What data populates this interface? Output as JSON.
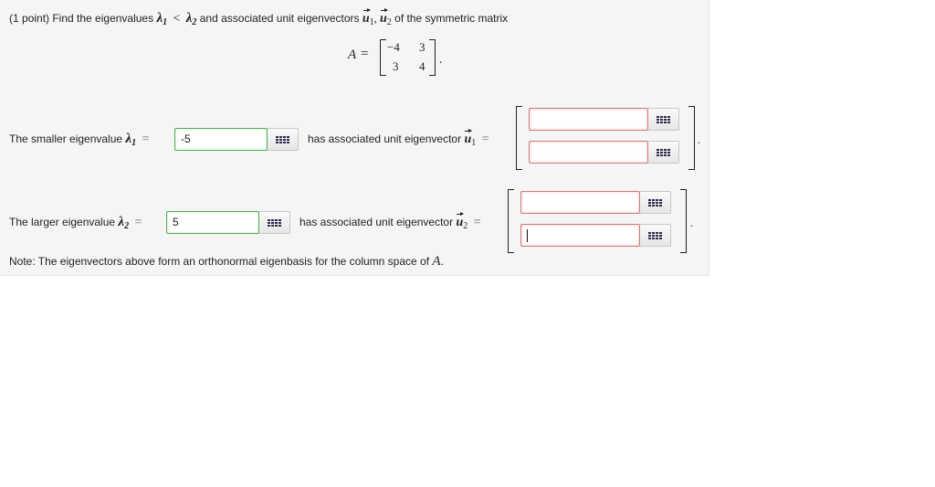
{
  "problem": {
    "prefix": "(1 point) Find the eigenvalues",
    "lambda": "λ",
    "one": "1",
    "two": "2",
    "lt": "<",
    "mid": "and associated unit eigenvectors",
    "u": "u",
    "comma": ",",
    "suffix": "of the symmetric matrix"
  },
  "matrix": {
    "name": "A",
    "eq": "=",
    "rows": [
      [
        "−4",
        "3"
      ],
      [
        "3",
        "4"
      ]
    ],
    "dot": "."
  },
  "row1": {
    "label": "The smaller eigenvalue",
    "eq": "=",
    "value": "-5",
    "eig_label": "has associated unit eigenvector",
    "vec_inputs": [
      "",
      ""
    ],
    "dot": "."
  },
  "row2": {
    "label": "The larger eigenvalue",
    "eq": "=",
    "value": "5",
    "eig_label": "has associated unit eigenvector",
    "vec_inputs": [
      "",
      ""
    ],
    "dot": "."
  },
  "note": {
    "text": "Note: The eigenvectors above form an orthonormal eigenbasis for the column space of",
    "matrix": "A",
    "dot": "."
  },
  "icons": {
    "palette": "equation-palette-grid-icon"
  },
  "colors": {
    "valid_border": "#4caf50",
    "invalid_border": "#d07b7b",
    "panel_bg": "#f5f5f5"
  }
}
